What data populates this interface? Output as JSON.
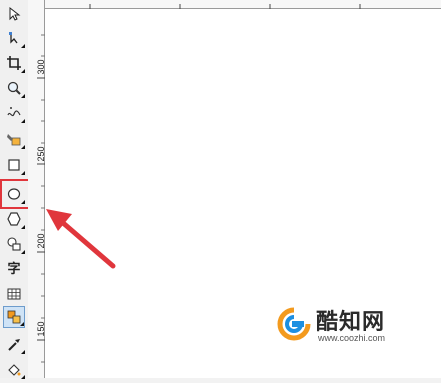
{
  "toolbox": {
    "tools": [
      {
        "name": "pick-tool",
        "icon": "arrow-pointer-icon"
      },
      {
        "name": "shape-tool",
        "icon": "node-edit-icon"
      },
      {
        "name": "crop-tool",
        "icon": "crop-icon"
      },
      {
        "name": "zoom-tool",
        "icon": "magnifier-icon"
      },
      {
        "name": "freehand-tool",
        "icon": "freehand-curve-icon"
      },
      {
        "name": "smart-fill-tool",
        "icon": "smart-fill-icon"
      },
      {
        "name": "rectangle-tool",
        "icon": "rectangle-icon"
      },
      {
        "name": "ellipse-tool",
        "icon": "ellipse-icon",
        "highlighted": true
      },
      {
        "name": "polygon-tool",
        "icon": "hexagon-icon"
      },
      {
        "name": "basic-shapes-tool",
        "icon": "basic-shapes-icon"
      },
      {
        "name": "text-tool",
        "icon": "text-icon",
        "glyph": "字"
      },
      {
        "name": "table-tool",
        "icon": "table-grid-icon"
      },
      {
        "name": "interactive-tool",
        "icon": "interactive-blend-icon",
        "active": true
      },
      {
        "name": "eyedropper-tool",
        "icon": "eyedropper-icon"
      },
      {
        "name": "fill-tool",
        "icon": "fill-bucket-icon"
      }
    ]
  },
  "ruler": {
    "vertical_labels": [
      "300",
      "250",
      "200",
      "150"
    ]
  },
  "watermark": {
    "name": "酷知网",
    "url": "www.coozhi.com"
  },
  "colors": {
    "highlight": "#e0363c",
    "arrow": "#e0363c",
    "logo_orange": "#f39a1e",
    "logo_blue": "#1d8fe1"
  }
}
